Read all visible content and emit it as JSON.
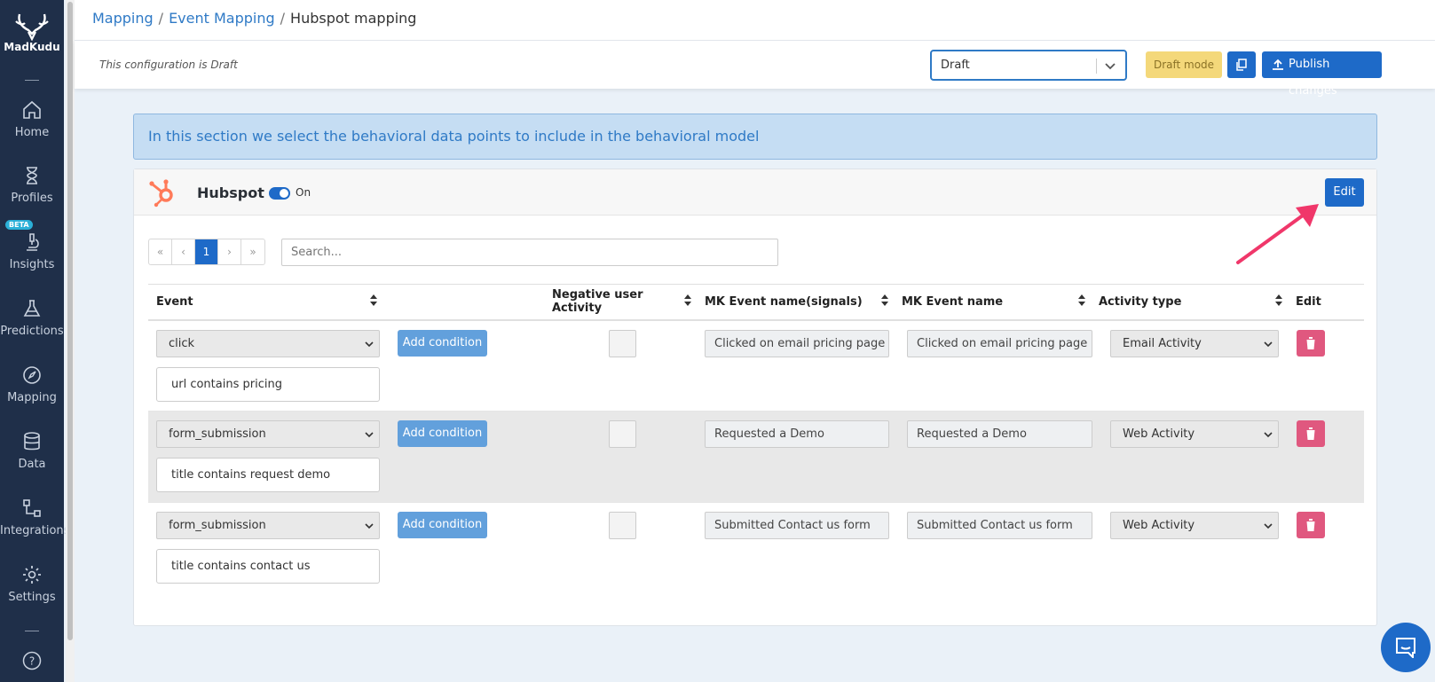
{
  "sidebar": {
    "brand": "MadKudu",
    "items": [
      {
        "label": "Home",
        "icon": "home-icon"
      },
      {
        "label": "Profiles",
        "icon": "hourglass-icon"
      },
      {
        "label": "Insights",
        "icon": "microscope-icon",
        "badge": "BETA"
      },
      {
        "label": "Predictions",
        "icon": "flask-icon"
      },
      {
        "label": "Mapping",
        "icon": "compass-icon"
      },
      {
        "label": "Data",
        "icon": "database-icon"
      },
      {
        "label": "Integrations",
        "icon": "integrations-icon"
      },
      {
        "label": "Settings",
        "icon": "gear-icon"
      }
    ],
    "help": "?"
  },
  "breadcrumb": {
    "items": [
      "Mapping",
      "Event Mapping"
    ],
    "current": "Hubspot mapping",
    "separator": "/"
  },
  "config": {
    "status_text": "This configuration is Draft",
    "version_select": "Draft",
    "draft_mode_label": "Draft mode",
    "publish_label": "Publish changes"
  },
  "info_banner": "In this section we select the behavioral data points to include in the behavioral model",
  "card": {
    "title": "Hubspot",
    "toggle_label": "On",
    "edit_label": "Edit"
  },
  "pager": {
    "first": "«",
    "prev": "‹",
    "page": "1",
    "next": "›",
    "last": "»"
  },
  "search": {
    "placeholder": "Search..."
  },
  "table": {
    "columns": [
      "Event",
      "",
      "Negative user Activity",
      "MK Event name(signals)",
      "MK Event name",
      "Activity type",
      "Edit"
    ],
    "add_condition_label": "Add condition",
    "rows": [
      {
        "event": "click",
        "condition": "url contains pricing",
        "negative": false,
        "signal_name": "Clicked on email pricing page link",
        "event_name": "Clicked on email pricing page link",
        "activity_type": "Email Activity"
      },
      {
        "event": "form_submission",
        "condition": "title contains request demo",
        "negative": false,
        "signal_name": "Requested a Demo",
        "event_name": "Requested a Demo",
        "activity_type": "Web Activity"
      },
      {
        "event": "form_submission",
        "condition": "title contains contact us",
        "negative": false,
        "signal_name": "Submitted Contact us form",
        "event_name": "Submitted Contact us form",
        "activity_type": "Web Activity"
      }
    ]
  },
  "colors": {
    "sidebar_bg": "#1f2f49",
    "primary": "#1e6ac8",
    "draft_badge": "#f4d87a",
    "delete": "#e0587f",
    "hubspot_orange": "#ff7a59",
    "annotation_arrow": "#f0376a"
  }
}
